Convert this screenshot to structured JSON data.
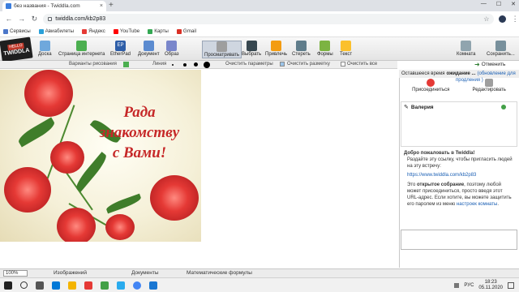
{
  "browser": {
    "tab_title": "без названия - Twiddla.com",
    "new_tab": "+",
    "tab_close": "×",
    "win_min": "—",
    "win_max": "☐",
    "win_close": "✕",
    "url": "twiddla.com/kb2p83",
    "bookmarks": [
      {
        "label": "Сервисы",
        "color": "#4a76c9"
      },
      {
        "label": "Авиабилеты",
        "color": "#2aa0d8"
      },
      {
        "label": "Яндекс",
        "color": "#e53935"
      },
      {
        "label": "YouTube",
        "color": "#ff0000"
      },
      {
        "label": "Карты",
        "color": "#34a853"
      },
      {
        "label": "Gmail",
        "color": "#d93025"
      }
    ]
  },
  "app": {
    "logo_hello": "HELLO",
    "logo_name": "TWIDDLA",
    "tools": [
      {
        "label": "Доска",
        "color": "#6fa8dc"
      },
      {
        "label": "Страница интернета",
        "color": "#4caf50"
      },
      {
        "label": "EtherPad",
        "color": "#2e5ea8",
        "badge": "EP"
      },
      {
        "label": "Документ",
        "color": "#5b8bd0"
      },
      {
        "label": "Образ",
        "color": "#7986cb"
      },
      {
        "label": "Просматривать",
        "color": "#9e9e9e"
      },
      {
        "label": "Выбрать",
        "color": "#37474f"
      },
      {
        "label": "Привлечь",
        "color": "#f39c12"
      },
      {
        "label": "Стереть",
        "color": "#607d8b"
      },
      {
        "label": "Формы",
        "color": "#7cb342"
      },
      {
        "label": "Текст",
        "color": "#fbc02d"
      }
    ],
    "room_label": "Комната",
    "save_label": "Сохранить...",
    "cancel_label": "Отменить",
    "sub": {
      "drawing_options": "Варианты рисования",
      "line": "Линия",
      "cleanup": "Очистить параметры",
      "clear_markup": "Очистить разметку",
      "clear_all": "Очистить все"
    }
  },
  "canvas": {
    "greeting_line1": "Рада",
    "greeting_line2": "знакомству",
    "greeting_line3": "с Вами!"
  },
  "panel": {
    "time_left": "Оставшееся время",
    "waiting": "ожидание ...",
    "refresh": "(обновление для",
    "refresh_cont": "продления )",
    "join": "Присоединиться",
    "edit": "Редактировать",
    "user_name": "Валерия",
    "welcome_title": "Добро пожаловать в Twiddla!",
    "welcome_invite": "Раздайте эту ссылку, чтобы пригласить людей на эту встречу:",
    "room_link": "https://www.twiddla.com/kb2p83",
    "open_meeting_pre": "Это",
    "open_meeting_bold": "открытое собрание",
    "open_meeting_post": ", поэтому любой может присоединиться, просто введя этот URL-адрес. Если хотите, вы можете защитить его паролем из меню",
    "room_settings": "настроек комнаты",
    "open_meeting_end": "."
  },
  "bottom": {
    "zoom": "100%",
    "images": "Изображений",
    "documents": "Документы",
    "math": "Математические формулы"
  },
  "taskbar": {
    "lang": "РУС",
    "time": "18:23",
    "date": "05.11.2020"
  }
}
